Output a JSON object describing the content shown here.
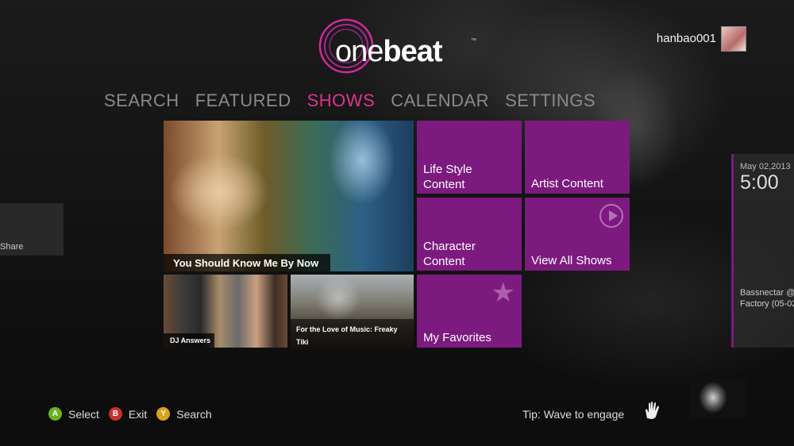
{
  "app": {
    "logo_text_light": "one",
    "logo_text_bold": "beat",
    "logo_tm": "™"
  },
  "user": {
    "name": "hanbao001"
  },
  "nav": {
    "items": [
      {
        "label": "SEARCH"
      },
      {
        "label": "FEATURED"
      },
      {
        "label": "SHOWS",
        "active": true
      },
      {
        "label": "CALENDAR"
      },
      {
        "label": "SETTINGS"
      }
    ]
  },
  "tiles": {
    "hero_caption": "You Should Know Me By Now",
    "dj_caption": "DJ Answers",
    "love_caption": "For the Love of Music: Freaky Tiki",
    "life_label": "Life Style Content",
    "artist_label": "Artist Content",
    "character_label": "Character Content",
    "all_shows_label": "View All Shows",
    "favorites_label": "My Favorites"
  },
  "left_panel": {
    "label": "Share"
  },
  "right_panel": {
    "date": "May 02,2013",
    "time": "5:00",
    "show": "Bassnectar @",
    "venue": "Factory (05-02"
  },
  "footer": {
    "buttons": [
      {
        "key": "A",
        "label": "Select",
        "color": "#6ab023"
      },
      {
        "key": "B",
        "label": "Exit",
        "color": "#c9302c"
      },
      {
        "key": "Y",
        "label": "Search",
        "color": "#d9a21b"
      }
    ],
    "tip": "Tip: Wave to engage"
  },
  "colors": {
    "accent": "#e0338f",
    "tile": "#7d1a7f"
  }
}
